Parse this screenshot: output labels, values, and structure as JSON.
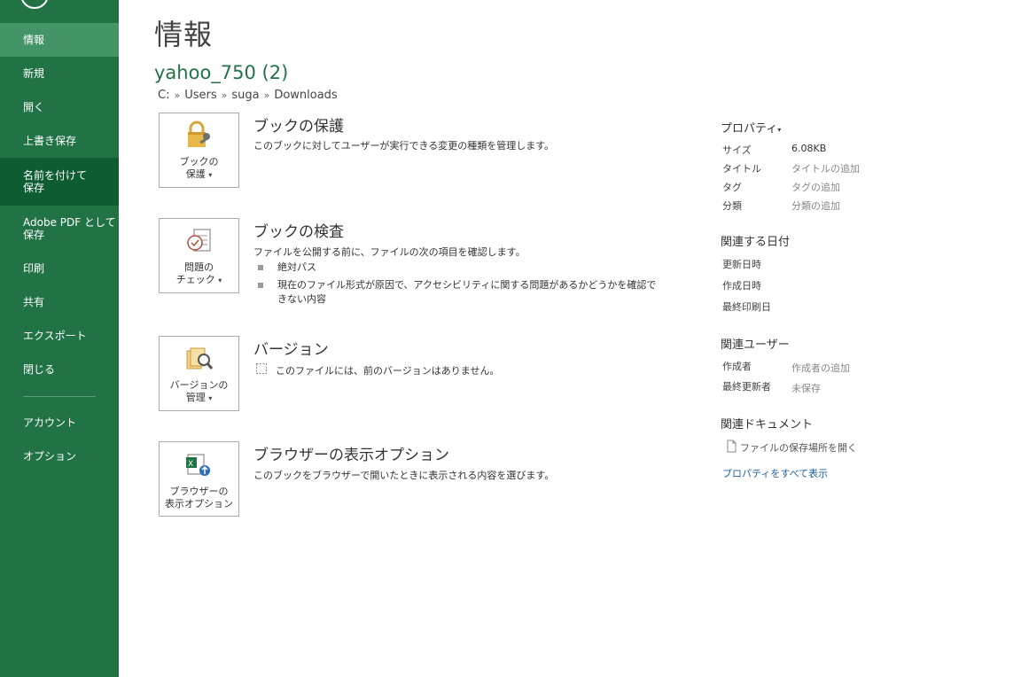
{
  "sidebar": {
    "items": [
      {
        "label": "情報"
      },
      {
        "label": "新規"
      },
      {
        "label": "開く"
      },
      {
        "label": "上書き保存"
      },
      {
        "label": "名前を付けて\n保存"
      },
      {
        "label": "Adobe PDF として\n保存"
      },
      {
        "label": "印刷"
      },
      {
        "label": "共有"
      },
      {
        "label": "エクスポート"
      },
      {
        "label": "閉じる"
      },
      {
        "label": "アカウント"
      },
      {
        "label": "オプション"
      }
    ]
  },
  "main": {
    "title": "情報",
    "file_name": "yahoo_750 (2)",
    "path": [
      "C:",
      "Users",
      "suga",
      "Downloads"
    ],
    "path_sep": "»",
    "sections": {
      "protect": {
        "button": [
          "ブックの",
          "保護"
        ],
        "title": "ブックの保護",
        "desc": "このブックに対してユーザーが実行できる変更の種類を管理します。"
      },
      "inspect": {
        "button": [
          "問題の",
          "チェック"
        ],
        "title": "ブックの検査",
        "desc": "ファイルを公開する前に、ファイルの次の項目を確認します。",
        "bullets": [
          "絶対パス",
          "現在のファイル形式が原因で、アクセシビリティに関する問題があるかどうかを確認できない内容"
        ]
      },
      "versions": {
        "button": [
          "バージョンの",
          "管理"
        ],
        "title": "バージョン",
        "desc": "このファイルには、前のバージョンはありません。"
      },
      "browser": {
        "button": [
          "ブラウザーの",
          "表示オプション"
        ],
        "title": "ブラウザーの表示オプション",
        "desc": "このブックをブラウザーで開いたときに表示される内容を選びます。"
      }
    }
  },
  "properties": {
    "heading": "プロパティ",
    "rows": [
      {
        "label": "サイズ",
        "value": "6.08KB"
      },
      {
        "label": "タイトル",
        "value": "タイトルの追加"
      },
      {
        "label": "タグ",
        "value": "タグの追加"
      },
      {
        "label": "分類",
        "value": "分類の追加"
      }
    ],
    "dates_heading": "関連する日付",
    "dates": [
      "更新日時",
      "作成日時",
      "最終印刷日"
    ],
    "people_heading": "関連ユーザー",
    "people": [
      {
        "label": "作成者",
        "value": "作成者の追加"
      },
      {
        "label": "最終更新者",
        "value": "未保存"
      }
    ],
    "docs_heading": "関連ドキュメント",
    "open_location": "ファイルの保存場所を開く",
    "show_all": "プロパティをすべて表示"
  },
  "colors": {
    "sidebar": "#217346",
    "sidebar_active": "#439467",
    "sidebar_hover": "#0e5c32",
    "accent_text": "#217346",
    "link": "#1f5f9e"
  }
}
